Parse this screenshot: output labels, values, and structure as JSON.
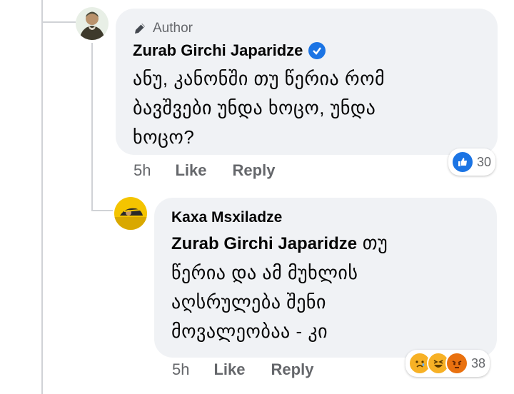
{
  "comment": {
    "badge": "Author",
    "author": "Zurab Girchi Japaridze",
    "lines": [
      "ანუ, კანონში თუ წერია რომ",
      "ბავშვები უნდა ხოცო, უნდა",
      "ხოცო?"
    ],
    "time": "5h",
    "like": "Like",
    "reply": "Reply",
    "reaction_count": "30"
  },
  "reply": {
    "author": "Kaxa Msxiladze",
    "mention": "Zurab Girchi Japaridze",
    "line1_rest": " თუ",
    "lines": [
      "წერია და ამ მუხლის",
      "აღსრულება შენი",
      "მოვალეობაა - კი"
    ],
    "time": "5h",
    "like": "Like",
    "reply": "Reply",
    "reaction_count": "38"
  },
  "colors": {
    "bubble": "#f0f2f5",
    "verified": "#1b74e4",
    "like": "#1b74e4"
  }
}
